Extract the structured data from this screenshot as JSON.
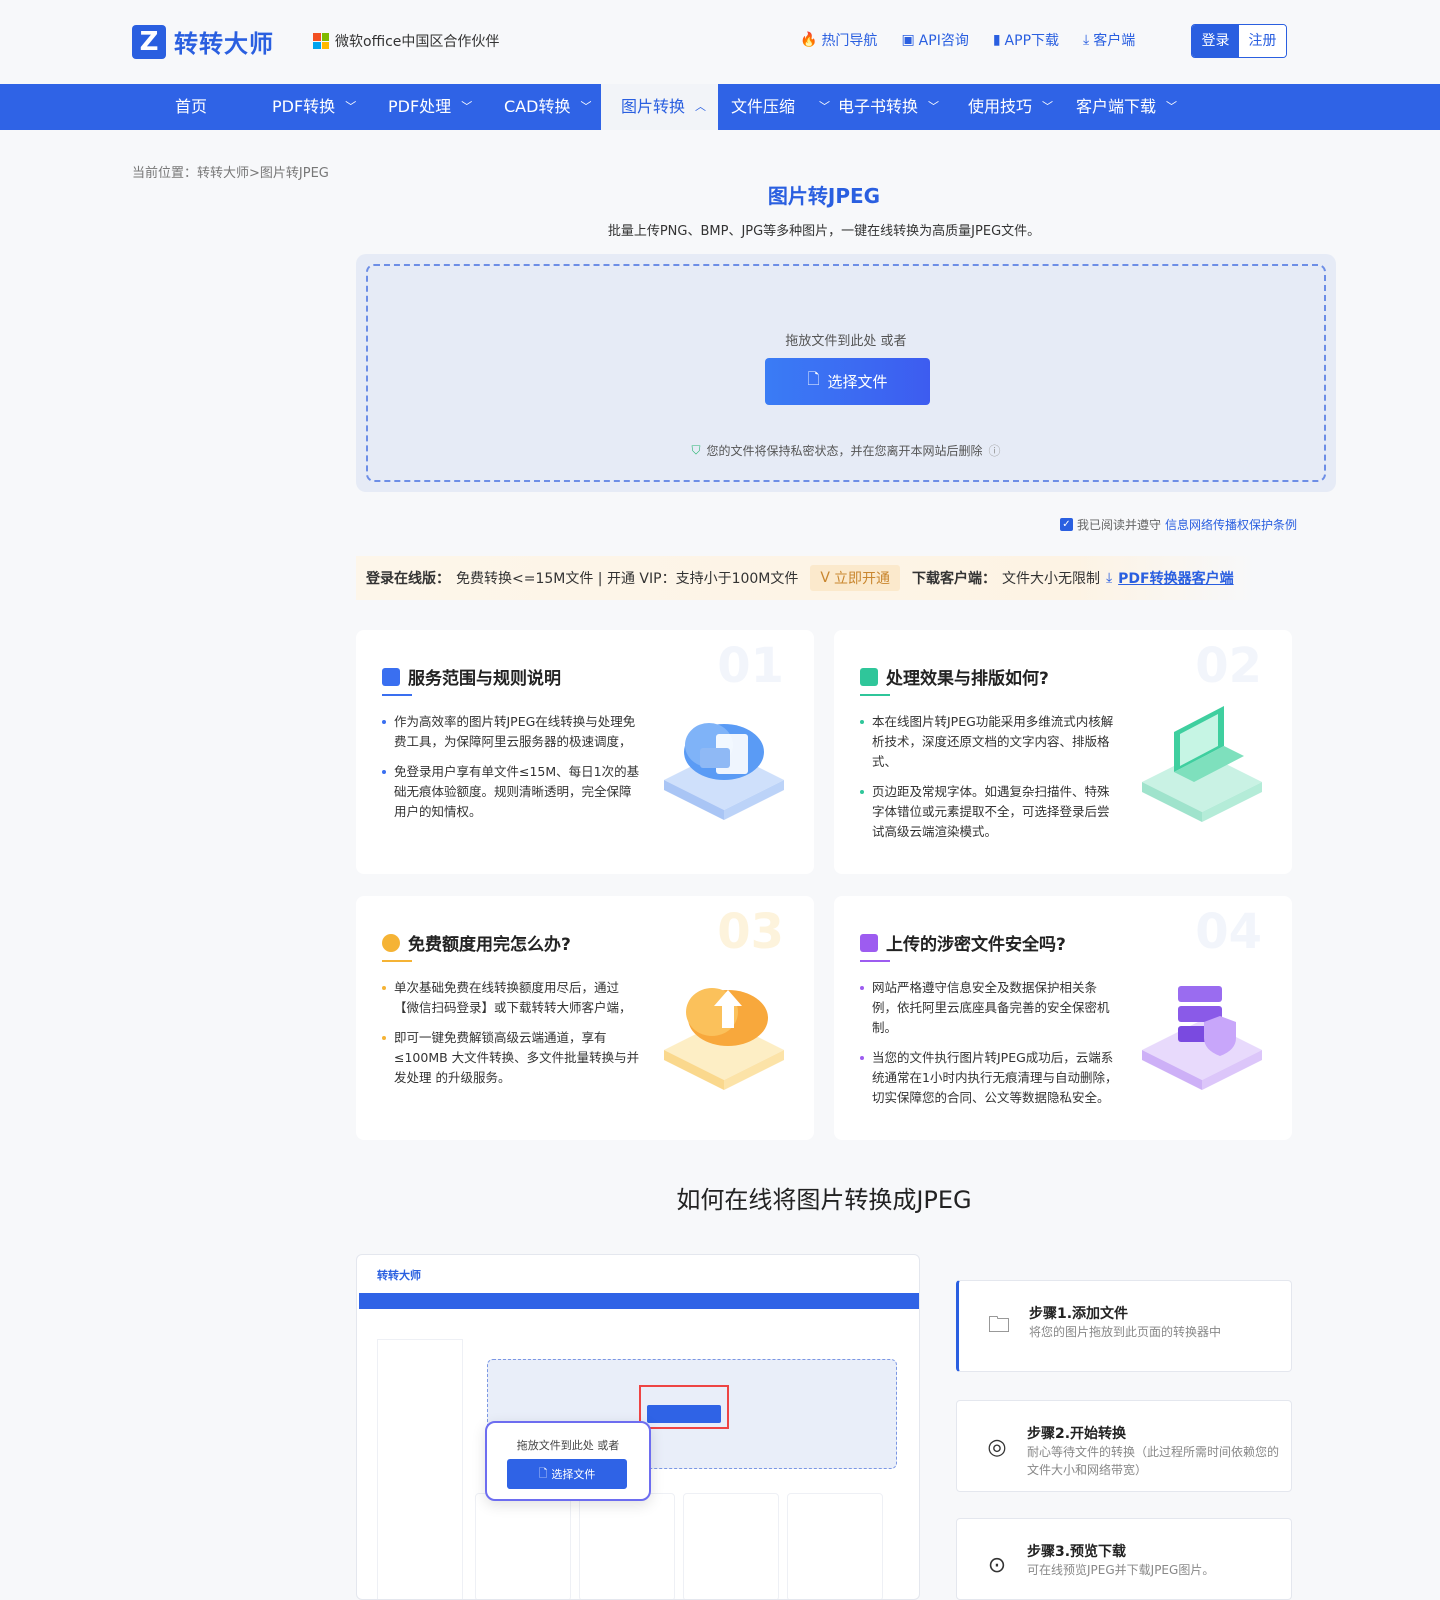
{
  "header": {
    "logo_mark": "Z",
    "logo_text": "转转大师",
    "partner": "微软office中国区合作伙伴",
    "links": [
      {
        "label": "热门导航",
        "icon": "fire-icon"
      },
      {
        "label": "API咨询",
        "icon": "chat-icon"
      },
      {
        "label": "APP下载",
        "icon": "phone-icon"
      },
      {
        "label": "客户端",
        "icon": "download-icon"
      }
    ],
    "login": "登录",
    "register": "注册"
  },
  "nav": {
    "items": [
      "首页",
      "PDF转换",
      "PDF处理",
      "CAD转换",
      "图片转换",
      "文件压缩",
      "电子书转换",
      "使用技巧",
      "客户端下载"
    ]
  },
  "breadcrumb": "当前位置：转转大师>图片转JPEG",
  "page": {
    "title": "图片转JPEG",
    "subtitle": "批量上传PNG、BMP、JPG等多种图片，一键在线转换为高质量JPEG文件。"
  },
  "upload": {
    "drop_text": "拖放文件到此处 或者",
    "button": "选择文件",
    "privacy": "您的文件将保持私密状态，并在您离开本网站后删除"
  },
  "agree": {
    "text": "我已阅读并遵守",
    "link": "信息网络传播权保护条例"
  },
  "promo": {
    "label1": "登录在线版：",
    "text1": "免费转换<=15M文件 | 开通 VIP：支持小于100M文件",
    "vip": "立即开通",
    "label2": "下载客户端：",
    "text2": "文件大小无限制",
    "link": "PDF转换器客户端"
  },
  "cards": [
    {
      "num": "01",
      "title": "服务范围与规则说明",
      "items": [
        "作为高效率的图片转JPEG在线转换与处理免费工具，为保障阿里云服务器的极速调度，",
        "免登录用户享有单文件≤15M、每日1次的基础无痕体验额度。规则清晰透明，完全保障用户的知情权。"
      ]
    },
    {
      "num": "02",
      "title": "处理效果与排版如何?",
      "items": [
        "本在线图片转JPEG功能采用多维流式内核解析技术，深度还原文档的文字内容、排版格式、",
        "页边距及常规字体。如遇复杂扫描件、特殊字体错位或元素提取不全，可选择登录后尝试高级云端渲染模式。"
      ]
    },
    {
      "num": "03",
      "title": "免费额度用完怎么办?",
      "items": [
        "单次基础免费在线转换额度用尽后，通过【微信扫码登录】或下载转转大师客户端，",
        "即可一键免费解锁高级云端通道，享有≤100MB 大文件转换、多文件批量转换与并发处理 的升级服务。"
      ]
    },
    {
      "num": "04",
      "title": "上传的涉密文件安全吗?",
      "items": [
        "网站严格遵守信息安全及数据保护相关条例，依托阿里云底座具备完善的安全保密机制。",
        "当您的文件执行图片转JPEG成功后，云端系统通常在1小时内执行无痕清理与自动删除，切实保障您的合同、公文等数据隐私安全。"
      ]
    }
  ],
  "howto": {
    "title": "如何在线将图片转换成JPEG",
    "preview_logo": "转转大师",
    "preview_drop": "拖放文件到此处 或者",
    "preview_button": "选择文件"
  },
  "steps": [
    {
      "title": "步骤1.添加文件",
      "desc": "将您的图片拖放到此页面的转换器中"
    },
    {
      "title": "步骤2.开始转换",
      "desc": "耐心等待文件的转换（此过程所需时间依赖您的文件大小和网络带宽）"
    },
    {
      "title": "步骤3.预览下载",
      "desc": "可在线预览JPEG并下载JPEG图片。"
    }
  ],
  "colors": {
    "brand": "#2a5fe0",
    "nav": "#2f63e6"
  }
}
